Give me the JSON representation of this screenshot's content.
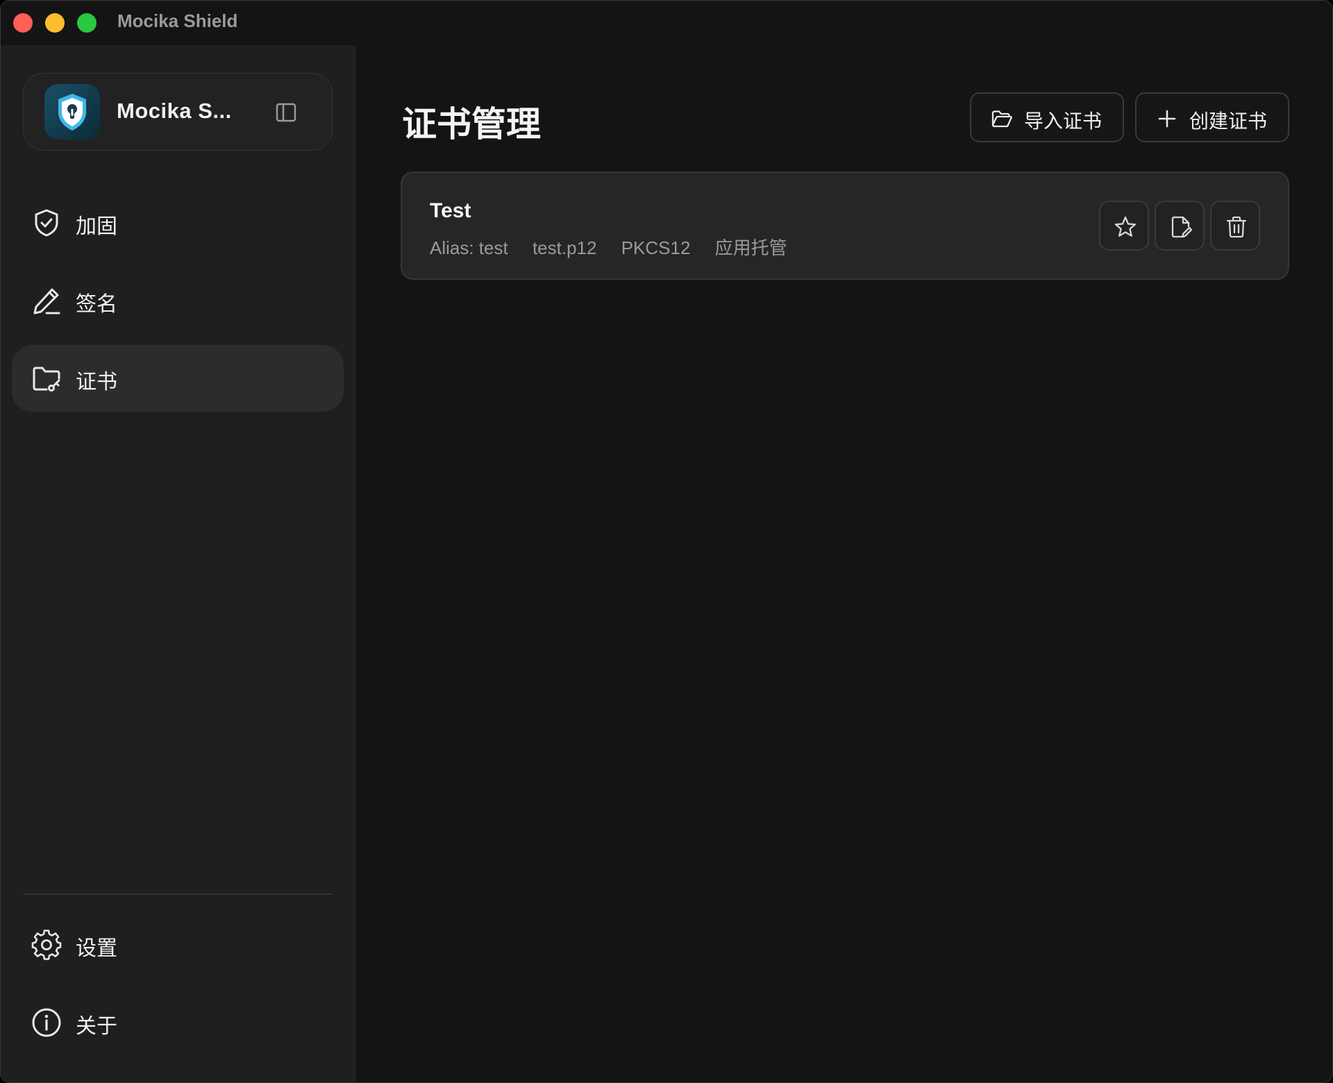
{
  "window": {
    "title": "Mocika Shield"
  },
  "sidebar": {
    "app_name": "Mocika S...",
    "items": [
      {
        "label": "加固",
        "icon": "shield-check-icon",
        "active": false
      },
      {
        "label": "签名",
        "icon": "pen-icon",
        "active": false
      },
      {
        "label": "证书",
        "icon": "folder-key-icon",
        "active": true
      }
    ],
    "footer_items": [
      {
        "label": "设置",
        "icon": "gear-icon"
      },
      {
        "label": "关于",
        "icon": "info-icon"
      }
    ]
  },
  "main": {
    "title": "证书管理",
    "import_label": "导入证书",
    "create_label": "创建证书",
    "certificates": [
      {
        "name": "Test",
        "alias": "Alias: test",
        "file": "test.p12",
        "format": "PKCS12",
        "storage": "应用托管"
      }
    ]
  },
  "colors": {
    "background": "#141414",
    "sidebar": "#1f1f1f",
    "active_item": "#2c2c2c",
    "card": "#262626",
    "close": "#fe5f57",
    "minimize": "#febc2e",
    "maximize": "#28c840"
  }
}
